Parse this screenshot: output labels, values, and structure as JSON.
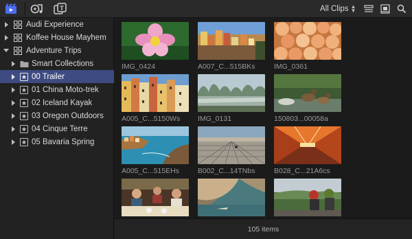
{
  "toolbar": {
    "clips_filter": "All Clips",
    "icons": [
      "library-icon",
      "photos-audio-icon",
      "titles-generators-icon",
      "filmstrip-view-icon",
      "clip-appearance-icon",
      "search-icon"
    ]
  },
  "sidebar": {
    "items": [
      {
        "label": "Audi Experience",
        "type": "library",
        "expanded": false
      },
      {
        "label": "Koffee House Mayhem",
        "type": "library",
        "expanded": false
      },
      {
        "label": "Adventure Trips",
        "type": "library",
        "expanded": true
      },
      {
        "label": "Smart Collections",
        "type": "folder",
        "expanded": false
      },
      {
        "label": "00 Trailer",
        "type": "event",
        "expanded": false,
        "selected": true
      },
      {
        "label": "01 China Moto-trek",
        "type": "event",
        "expanded": false
      },
      {
        "label": "02 Iceland Kayak",
        "type": "event",
        "expanded": false
      },
      {
        "label": "03 Oregon Outdoors",
        "type": "event",
        "expanded": false
      },
      {
        "label": "04 Cinque Terre",
        "type": "event",
        "expanded": false
      },
      {
        "label": "05 Bavaria Spring",
        "type": "event",
        "expanded": false
      }
    ]
  },
  "clips": [
    {
      "name": "IMG_0424"
    },
    {
      "name": "A007_C...515BKs"
    },
    {
      "name": "IMG_0361"
    },
    {
      "name": "A005_C...5150Ws"
    },
    {
      "name": "IMG_0131"
    },
    {
      "name": "150803...00058a"
    },
    {
      "name": "A005_C...515EHs"
    },
    {
      "name": "B002_C...14TNbs"
    },
    {
      "name": "B028_C...21A6cs"
    },
    {
      "name": ""
    },
    {
      "name": ""
    },
    {
      "name": ""
    }
  ],
  "footer": {
    "item_count": "105 items"
  },
  "colors": {
    "selection": "#3e4b82",
    "background": "#1b1b1b",
    "sidebar": "#222222"
  }
}
